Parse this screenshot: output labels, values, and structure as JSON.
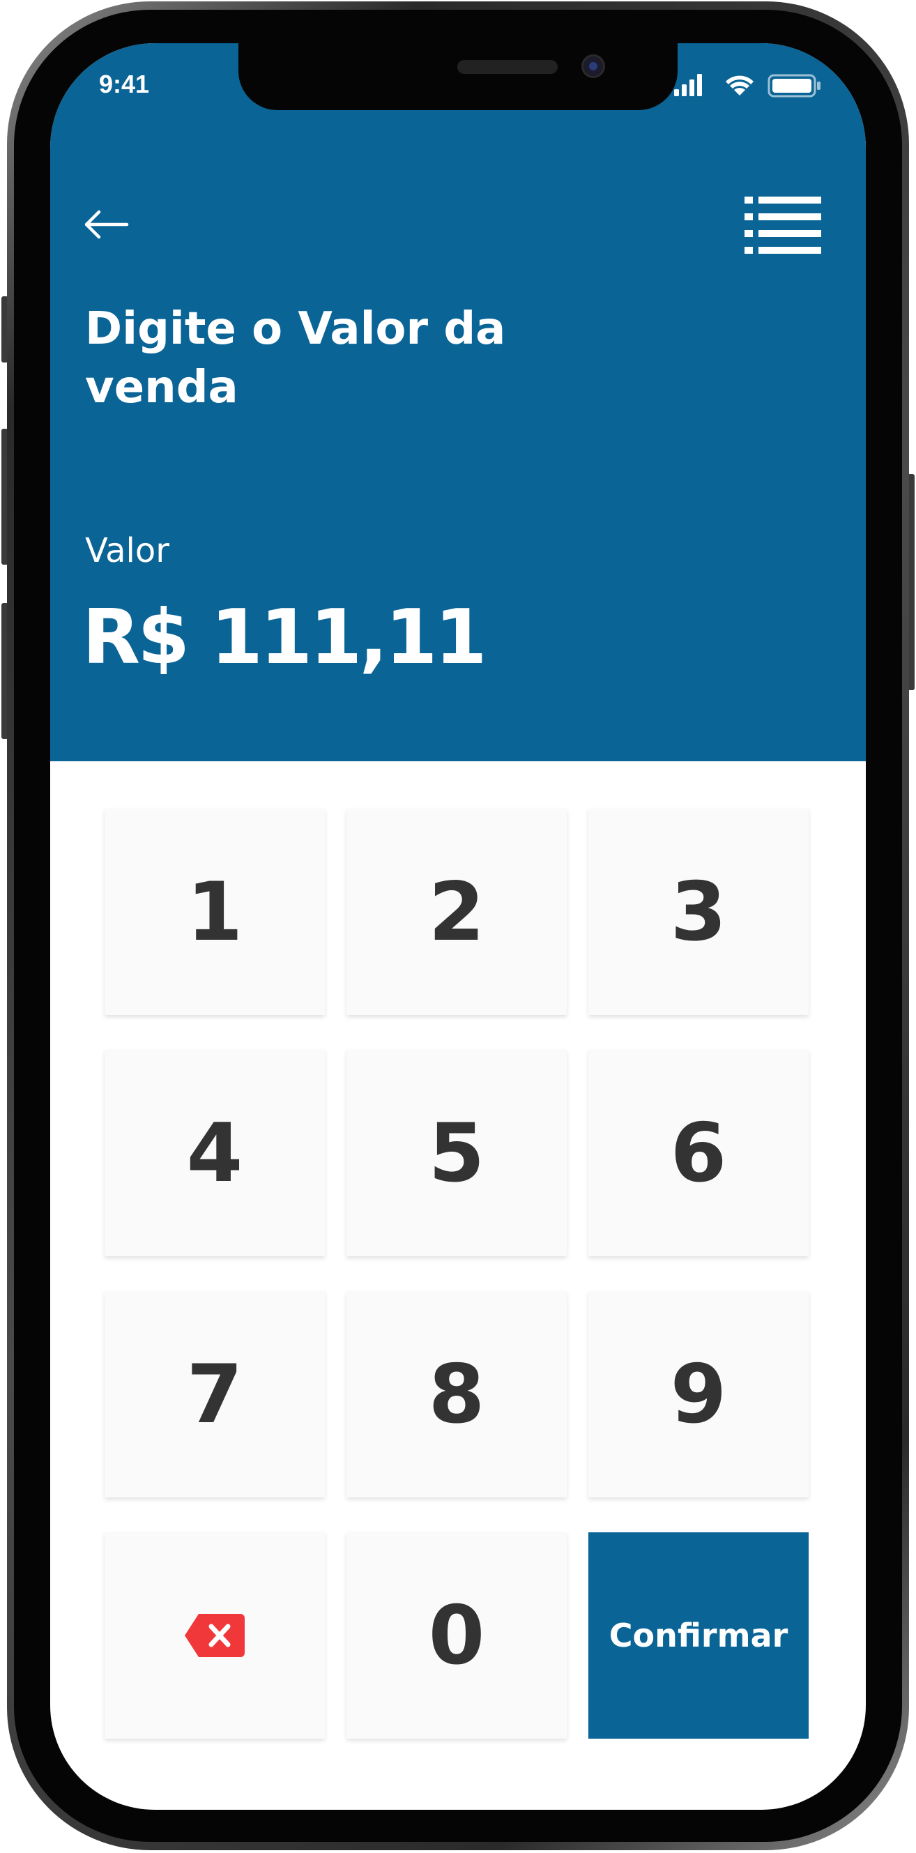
{
  "status_bar": {
    "time": "9:41",
    "icons": [
      "signal-icon",
      "wifi-icon",
      "battery-icon"
    ]
  },
  "header": {
    "back_icon": "arrow-left-icon",
    "menu_icon": "list-menu-icon",
    "title_line1": "Digite o Valor da",
    "title_line2": "venda",
    "value_label": "Valor",
    "value_amount": "R$ 111,11"
  },
  "keypad": {
    "keys": [
      "1",
      "2",
      "3",
      "4",
      "5",
      "6",
      "7",
      "8",
      "9"
    ],
    "zero": "0",
    "delete_icon": "backspace-icon",
    "confirm_label": "Confirmar"
  },
  "colors": {
    "primary": "#0a6496",
    "key_background": "#fafafa",
    "key_text": "#333333",
    "delete_red": "#f0383b"
  }
}
